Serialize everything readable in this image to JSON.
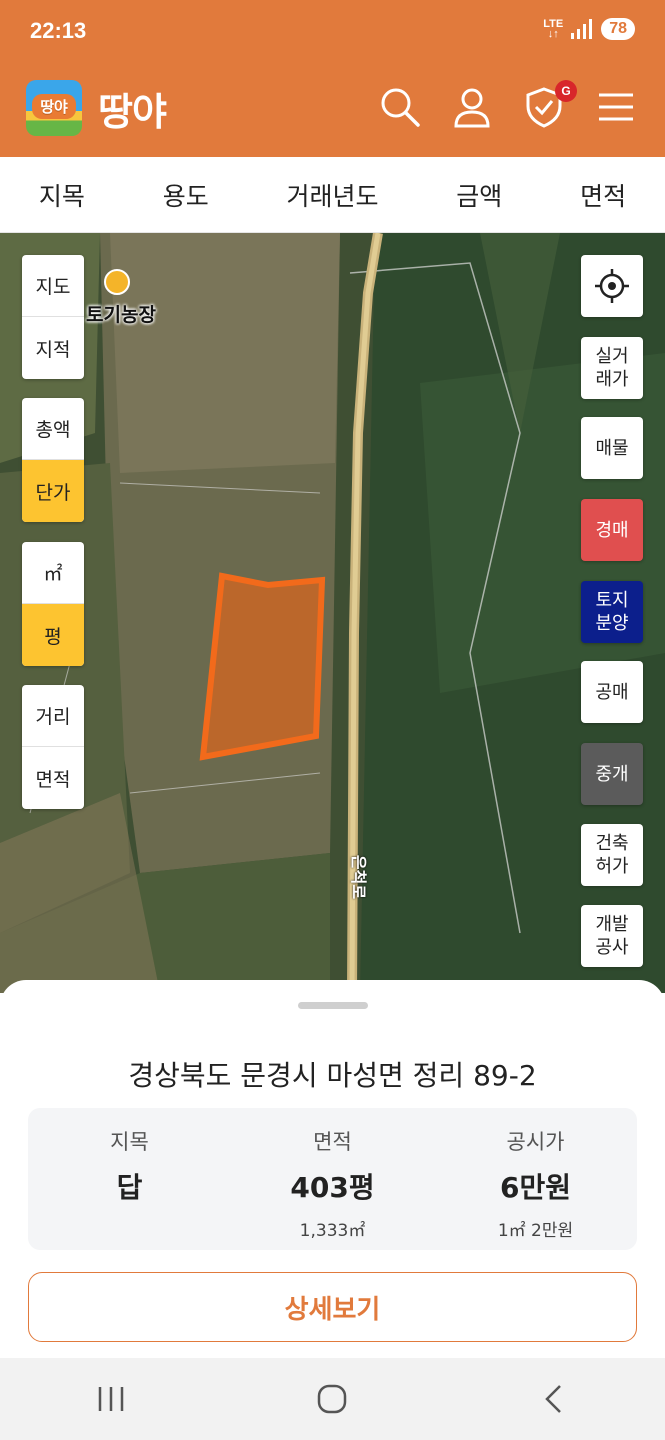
{
  "status": {
    "time": "22:13",
    "network": "LTE",
    "battery": "78"
  },
  "header": {
    "logo_badge": "땅야",
    "logo_text": "땅야",
    "notification_badge": "G"
  },
  "filters": [
    "지목",
    "용도",
    "거래년도",
    "금액",
    "면적"
  ],
  "map": {
    "place_label": "토기농장",
    "road_label": "은척로"
  },
  "left_controls": {
    "layer": [
      "지도",
      "지적"
    ],
    "price": [
      "총액",
      "단가"
    ],
    "unit": [
      "㎡",
      "평"
    ],
    "measure": [
      "거리",
      "면적"
    ]
  },
  "right_controls": {
    "real_trade": "실거\n래가",
    "listing": "매물",
    "auction": "경매",
    "land_sale": "토지\n분양",
    "public_sale": "공매",
    "brokerage": "중개",
    "building_permit": "건축\n허가",
    "development": "개발\n공사"
  },
  "sheet": {
    "address": "경상북도 문경시 마성면 정리 89-2",
    "land_type_label": "지목",
    "land_type_value": "답",
    "area_label": "면적",
    "area_value": "403평",
    "area_sub": "1,333㎡",
    "price_label": "공시가",
    "price_value": "6만원",
    "price_sub": "1㎡ 2만원",
    "detail_button": "상세보기"
  },
  "colors": {
    "brand": "#e17a3c",
    "active": "#fdc430",
    "auction": "#e04f4f",
    "land_sale": "#0c1f8c",
    "brokerage": "#5b5b5b"
  }
}
